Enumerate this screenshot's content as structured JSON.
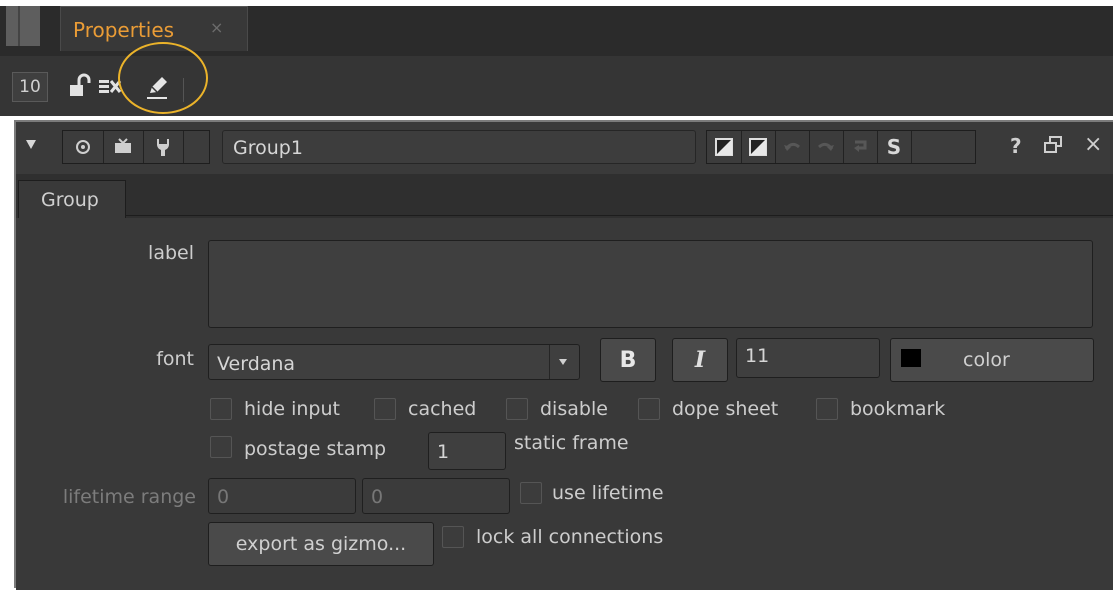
{
  "tab": {
    "title": "Properties",
    "close": "×"
  },
  "toolbar": {
    "max_panels": "10",
    "icons": [
      "lock-icon",
      "clear-panels-icon",
      "edit-icon"
    ]
  },
  "panel": {
    "node_name": "Group1",
    "header_buttons": [
      "viewer-icon",
      "tv-icon",
      "wrench-icon",
      "node-color-icon",
      "gl-color-icon",
      "undo-icon",
      "redo-icon",
      "revert-icon",
      "s-icon",
      "help-icon",
      "float-icon",
      "close-icon"
    ],
    "help": "?",
    "close": "×",
    "s_label": "S"
  },
  "tabs": [
    {
      "label": "Group"
    }
  ],
  "knobs": {
    "label": {
      "label": "label",
      "value": ""
    },
    "font": {
      "label": "font",
      "family": "Verdana",
      "bold": "B",
      "italic": "I",
      "size": "11",
      "color_label": "color",
      "color_swatch": "#000000"
    },
    "checkboxes": [
      {
        "label": "hide input",
        "checked": false
      },
      {
        "label": "cached",
        "checked": false
      },
      {
        "label": "disable",
        "checked": false
      },
      {
        "label": "dope sheet",
        "checked": false
      },
      {
        "label": "bookmark",
        "checked": false
      }
    ],
    "postage": {
      "label": "postage stamp",
      "checked": false,
      "frame": "1",
      "frame_label": "static frame"
    },
    "lifetime": {
      "label": "lifetime range",
      "start": "0",
      "end": "0",
      "use_label": "use lifetime",
      "checked": false
    },
    "export_label": "export as gizmo...",
    "lock_label": "lock all connections",
    "lock_checked": false
  },
  "colors": {
    "accent": "#ea9c36",
    "highlight": "#ebb32a",
    "panel_bg": "#393939"
  }
}
